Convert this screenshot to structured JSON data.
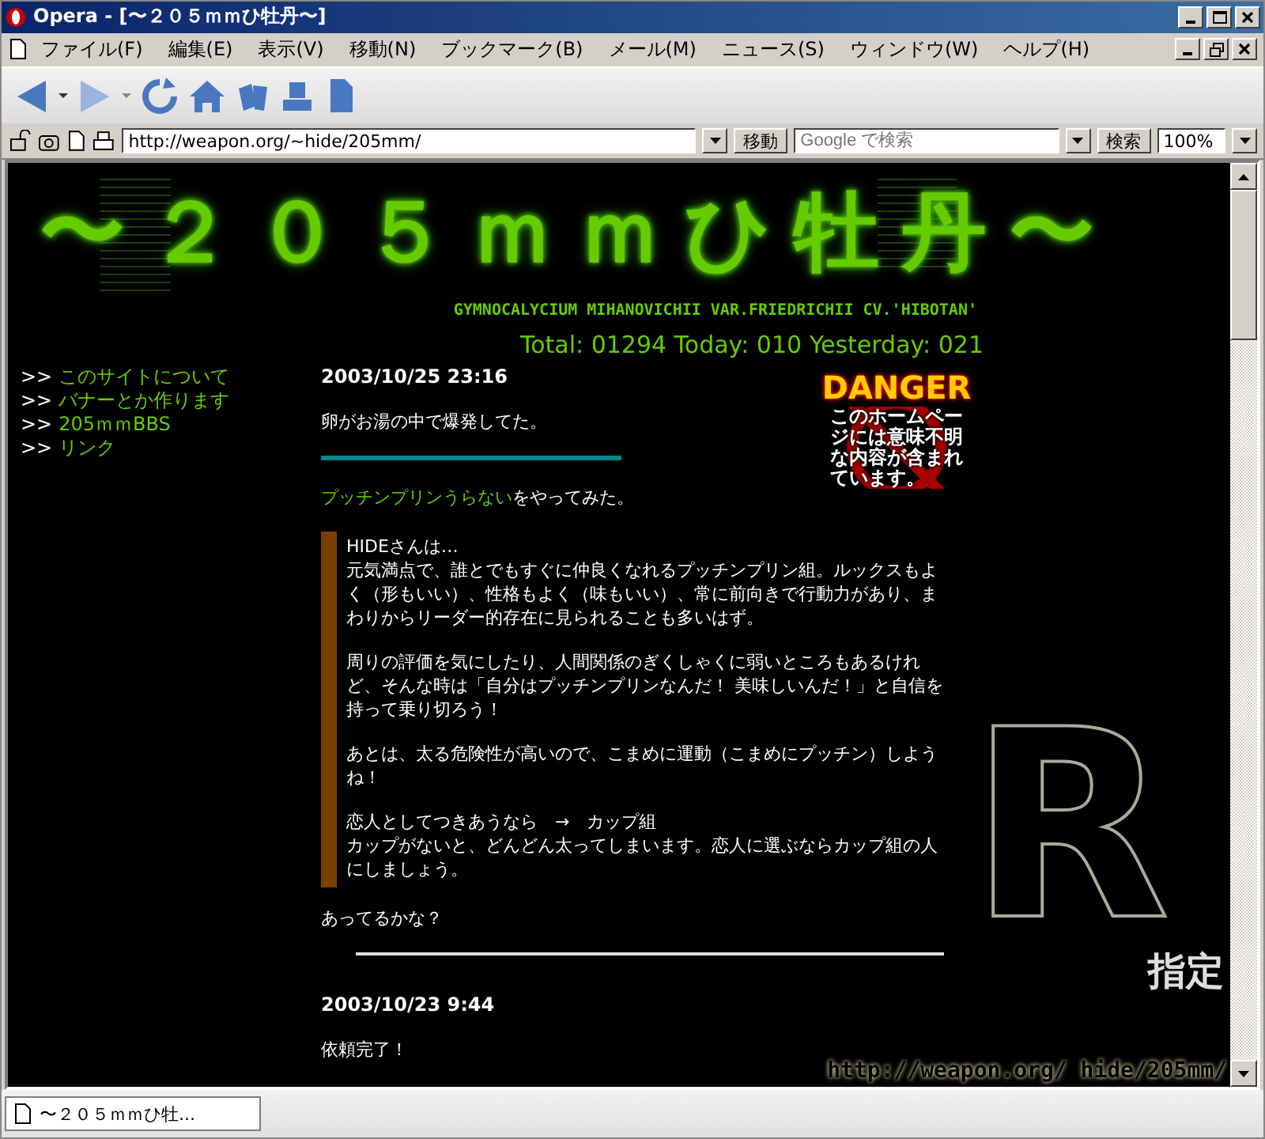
{
  "window": {
    "title": "Opera - [〜２０５ｍｍひ牡丹〜]"
  },
  "menu": [
    "ファイル(F)",
    "編集(E)",
    "表示(V)",
    "移動(N)",
    "ブックマーク(B)",
    "メール(M)",
    "ニュース(S)",
    "ウィンドウ(W)",
    "ヘルプ(H)"
  ],
  "address_bar": {
    "url": "http://weapon.org/~hide/205mm/",
    "go_button": "移動",
    "search_placeholder": "Google で検索",
    "search_button": "検索",
    "zoom": "100%"
  },
  "page": {
    "title": "〜２０５ｍｍひ牡丹〜",
    "subtitle": "GYMNOCALYCIUM MIHANOVICHII VAR.FRIEDRICHII CV.'HIBOTAN'",
    "counter": "Total: 01294 Today: 010 Yesterday: 021",
    "nav": [
      {
        "marker": ">>",
        "label": "このサイトについて"
      },
      {
        "marker": ">>",
        "label": "バナーとか作ります"
      },
      {
        "marker": ">>",
        "label": "205ｍｍBBS"
      },
      {
        "marker": ">>",
        "label": "リンク"
      }
    ],
    "danger": {
      "heading": "DANGER",
      "text": "このホームページには意味不明な内容が含まれています。"
    },
    "rating": {
      "letter": "R",
      "label": "指定",
      "url": "http://weapon.org/ hide/205mm/"
    },
    "posts": [
      {
        "date": "2003/10/25 23:16",
        "blocks": [
          {
            "kind": "text",
            "text": "卵がお湯の中で爆発してた。"
          },
          {
            "kind": "divider"
          },
          {
            "kind": "link_text",
            "link": "プッチンプリンうらない",
            "text": "をやってみた。"
          },
          {
            "kind": "quote",
            "paragraphs": [
              [
                "HIDEさんは…",
                "元気満点で、誰とでもすぐに仲良くなれるプッチンプリン組。ルックスもよく（形もいい）、性格もよく（味もいい）、常に前向きで行動力があり、まわりからリーダー的存在に見られることも多いはず。"
              ],
              [
                "周りの評価を気にしたり、人間関係のぎくしゃくに弱いところもあるけれど、そんな時は「自分はプッチンプリンなんだ！ 美味しいんだ！」と自信を持って乗り切ろう！"
              ],
              [
                "あとは、太る危険性が高いので、こまめに運動（こまめにプッチン）しようね！"
              ],
              [
                "恋人としてつきあうなら　→　カップ組",
                "カップがないと、どんどん太ってしまいます。恋人に選ぶならカップ組の人にしましょう。"
              ]
            ]
          },
          {
            "kind": "text",
            "text": "あってるかな？"
          }
        ]
      },
      {
        "date": "2003/10/23 9:44",
        "blocks": [
          {
            "kind": "text",
            "text": "依頼完了！"
          }
        ]
      }
    ]
  },
  "tabs": [
    {
      "label": "〜２０５ｍｍひ牡...",
      "selected": true
    }
  ]
}
